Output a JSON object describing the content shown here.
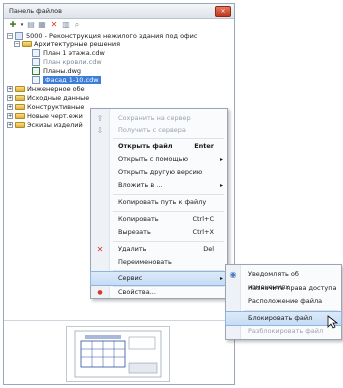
{
  "panel": {
    "title": "Панель файлов",
    "close_glyph": "×"
  },
  "toolbar": {
    "icons": [
      "add-icon",
      "dropdown-icon",
      "view-icon",
      "list-icon",
      "delete-icon",
      "details-icon",
      "search-icon"
    ]
  },
  "tree": {
    "project": "5000 - Реконструкция нежилого здания под офис",
    "arch_folder": "Архитектурные решения",
    "files": [
      "План 1 этажа.cdw",
      "План кровли.cdw",
      "Планы.dwg",
      "Фасад 1-10.cdw"
    ],
    "folders": [
      "Инженерное обе",
      "Исходные данные",
      "Конструктивные",
      "Новые черт.ежи",
      "Эскизы изделий"
    ]
  },
  "context_menu": {
    "items": [
      {
        "label": "Сохранить на сервер",
        "icon": "save-server-icon",
        "disabled": true
      },
      {
        "label": "Получить с сервера",
        "icon": "get-server-icon",
        "disabled": true
      },
      {
        "label": "Открыть файл",
        "shortcut": "Enter",
        "bold": true
      },
      {
        "label": "Открыть с помощью",
        "submenu": true
      },
      {
        "label": "Открыть другую версию"
      },
      {
        "label": "Вложить в ...",
        "submenu": true
      },
      {
        "label": "Копировать путь к файлу"
      },
      {
        "label": "Копировать",
        "shortcut": "Ctrl+C"
      },
      {
        "label": "Вырезать",
        "shortcut": "Ctrl+X"
      },
      {
        "label": "Удалить",
        "shortcut": "Del",
        "icon": "delete-icon"
      },
      {
        "label": "Переименовать"
      },
      {
        "label": "Сервис",
        "submenu": true,
        "hover": true
      },
      {
        "label": "Свойства...",
        "icon": "properties-icon"
      }
    ],
    "arrow_glyph": "▸"
  },
  "submenu": {
    "items": [
      {
        "label": "Уведомлять об изменениях",
        "icon": "notify-icon"
      },
      {
        "label": "Назначить права доступа"
      },
      {
        "label": "Расположение файла"
      },
      {
        "label": "Блокировать файл",
        "hover": true
      },
      {
        "label": "Разблокировать файл",
        "disabled": true
      }
    ]
  },
  "colors": {
    "selection": "#3b7dd8",
    "hover": "#c5dcf5",
    "delete_red": "#d23a2a",
    "folder": "#dfb23c"
  }
}
